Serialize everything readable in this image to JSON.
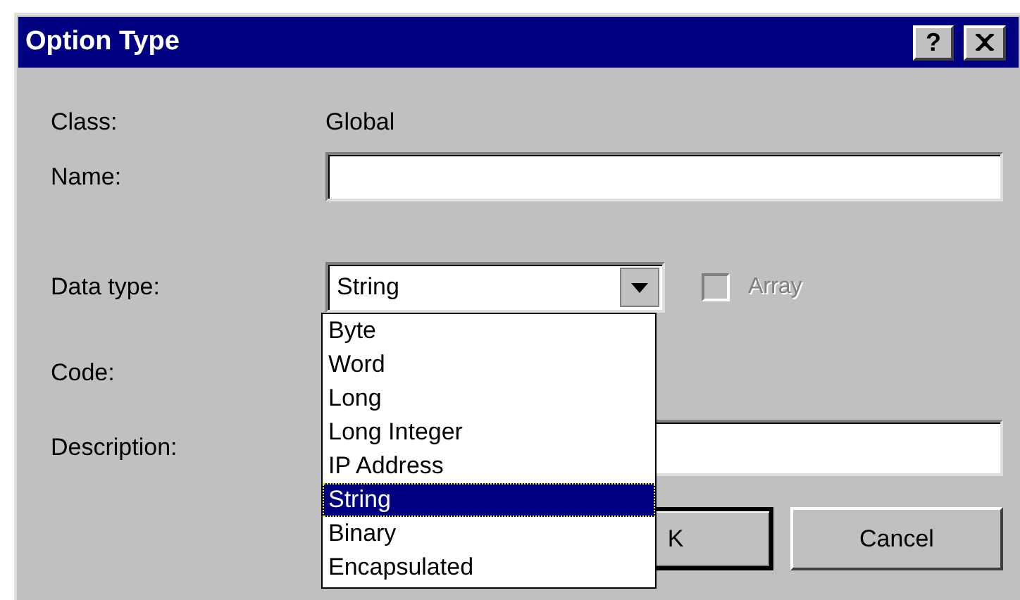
{
  "window": {
    "title": "Option Type",
    "help_button": "?"
  },
  "fields": [
    {
      "kind": "static",
      "label": "Class:",
      "value": "Global"
    },
    {
      "kind": "text",
      "label": "Name:"
    },
    {
      "kind": "combo",
      "label": "Data type:",
      "value": "String",
      "expanded": true
    },
    {
      "kind": "hidden",
      "label": "Code:"
    },
    {
      "kind": "text",
      "label": "Description:"
    }
  ],
  "array_checkbox": {
    "label": "Array",
    "checked": false,
    "disabled": true
  },
  "dropdown_options": [
    {
      "label": "Byte",
      "selected": false
    },
    {
      "label": "Word",
      "selected": false
    },
    {
      "label": "Long",
      "selected": false
    },
    {
      "label": "Long Integer",
      "selected": false
    },
    {
      "label": "IP Address",
      "selected": false
    },
    {
      "label": "String",
      "selected": true
    },
    {
      "label": "Binary",
      "selected": false
    },
    {
      "label": "Encapsulated",
      "selected": false
    }
  ],
  "buttons": [
    {
      "kind": "ok",
      "label": "K",
      "default": true
    },
    {
      "kind": "cancel",
      "label": "Cancel",
      "default": false
    }
  ]
}
